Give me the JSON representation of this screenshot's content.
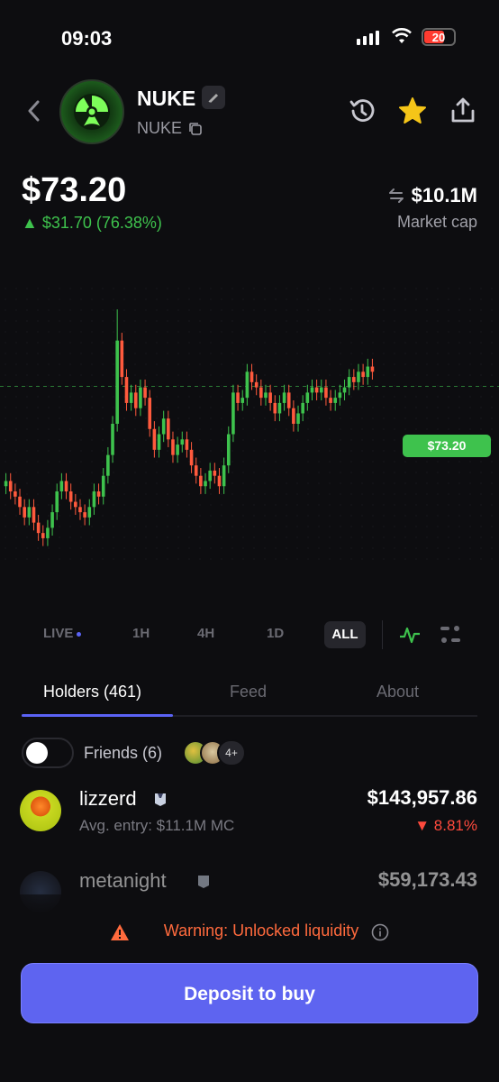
{
  "status_bar": {
    "time": "09:03",
    "battery": "20"
  },
  "token": {
    "name": "NUKE",
    "ticker": "NUKE"
  },
  "price": {
    "current": "$73.20",
    "change": "▲ $31.70 (76.38%)",
    "market_cap": "$10.1M",
    "market_cap_label": "Market cap",
    "tag": "$73.20"
  },
  "timeframes": {
    "live": "LIVE",
    "h1": "1H",
    "h4": "4H",
    "d1": "1D",
    "all": "ALL",
    "selected": "ALL"
  },
  "tabs": {
    "holders": "Holders (461)",
    "feed": "Feed",
    "about": "About",
    "active": "holders"
  },
  "friends": {
    "label": "Friends (6)",
    "more": "4+",
    "toggle_on": false
  },
  "holders": [
    {
      "name": "lizzerd",
      "sub": "Avg. entry: $11.1M MC",
      "value": "$143,957.86",
      "pct": "▼ 8.81%"
    },
    {
      "name": "metanight",
      "value": "$59,173.43"
    }
  ],
  "warning": {
    "text": "Warning: Unlocked liquidity"
  },
  "cta": {
    "label": "Deposit to buy"
  },
  "colors": {
    "accent": "#5e64f0",
    "up": "#3ec24d",
    "down": "#ff4a3d",
    "warning": "#ff6a3d"
  },
  "chart_data": {
    "type": "candlestick",
    "last_price": 73.2,
    "closes": [
      55,
      53,
      52,
      50,
      48,
      50,
      47,
      45,
      44,
      46,
      49,
      53,
      55,
      53,
      51,
      50,
      49,
      48,
      50,
      53,
      52,
      56,
      60,
      66,
      82,
      75,
      70,
      72,
      69,
      73,
      71,
      65,
      61,
      64,
      67,
      63,
      60,
      62,
      63,
      61,
      58,
      56,
      54,
      55,
      57,
      56,
      54,
      58,
      64,
      72,
      70,
      71,
      76,
      74,
      73,
      71,
      72,
      70,
      68,
      70,
      72,
      69,
      66,
      68,
      70,
      72,
      73,
      72,
      73,
      71,
      70,
      71,
      72,
      73,
      75,
      74,
      76,
      75,
      77,
      76
    ]
  }
}
